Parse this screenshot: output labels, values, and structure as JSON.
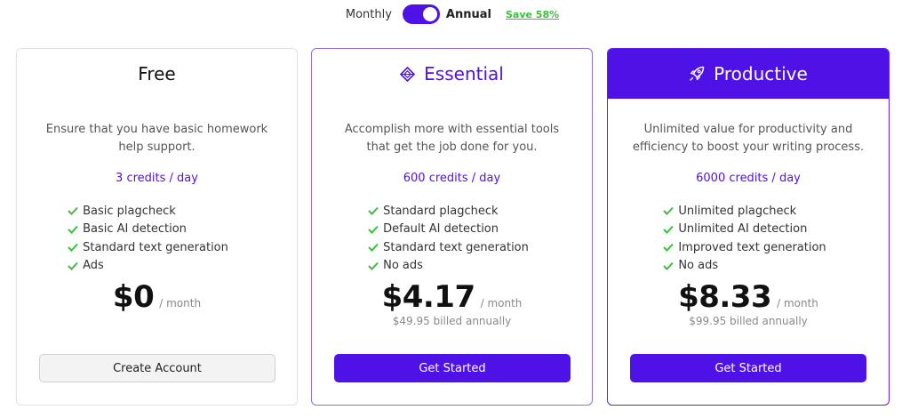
{
  "billing_toggle": {
    "monthly_label": "Monthly",
    "annual_label": "Annual",
    "save_label": "Save 58%",
    "selected": "Annual"
  },
  "colors": {
    "accent": "#4f12e6",
    "check": "#37c23a"
  },
  "plans": [
    {
      "name": "Free",
      "icon": "none",
      "description": "Ensure that you have basic homework help support.",
      "credits": "3 credits / day",
      "features": [
        "Basic plagcheck",
        "Basic AI detection",
        "Standard text generation",
        "Ads"
      ],
      "price": "$0",
      "period": "/ month",
      "billed": "",
      "cta": "Create Account"
    },
    {
      "name": "Essential",
      "icon": "diamond-icon",
      "description": "Accomplish more with essential tools that get the job done for you.",
      "credits": "600 credits / day",
      "features": [
        "Standard plagcheck",
        "Default AI detection",
        "Standard text generation",
        "No ads"
      ],
      "price": "$4.17",
      "period": "/ month",
      "billed": "$49.95 billed annually",
      "cta": "Get Started"
    },
    {
      "name": "Productive",
      "icon": "rocket-icon",
      "description": "Unlimited value for productivity and efficiency to boost your writing process.",
      "credits": "6000 credits / day",
      "features": [
        "Unlimited plagcheck",
        "Unlimited AI detection",
        "Improved text generation",
        "No ads"
      ],
      "price": "$8.33",
      "period": "/ month",
      "billed": "$99.95 billed annually",
      "cta": "Get Started"
    }
  ]
}
